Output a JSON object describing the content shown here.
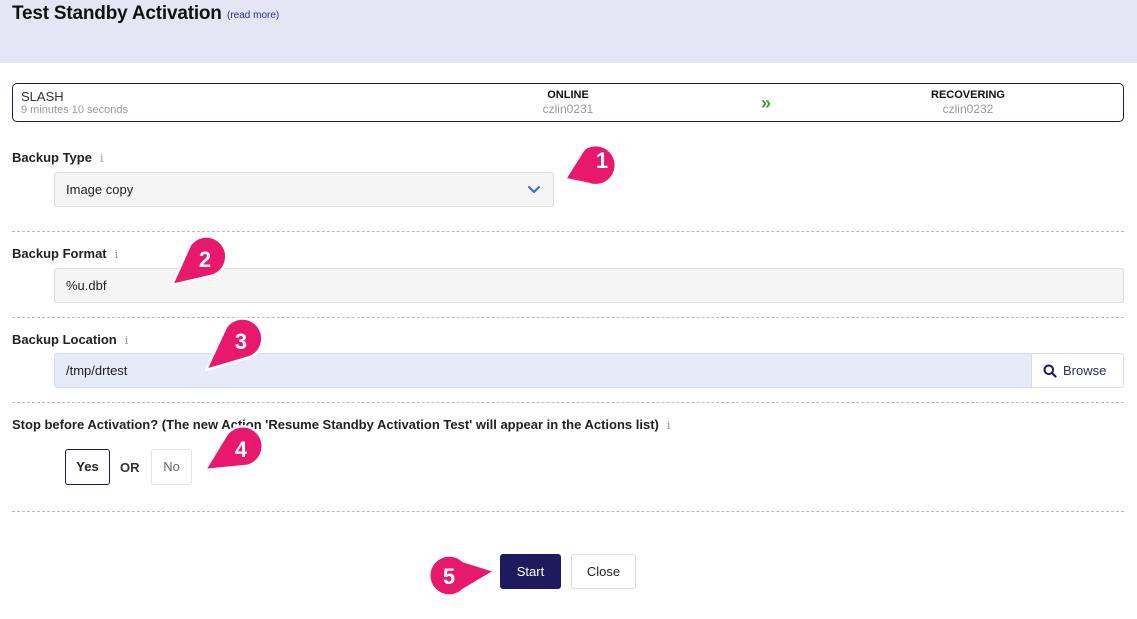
{
  "header": {
    "title": "Test Standby Activation",
    "read_more": "(read more)"
  },
  "status": {
    "db_name": "SLASH",
    "elapsed": "9 minutes 10 seconds",
    "primary_state": "ONLINE",
    "primary_host": "czlin0231",
    "standby_state": "RECOVERING",
    "standby_host": "czlin0232",
    "arrow": "»",
    "arrow_color": "#3aa32a"
  },
  "form": {
    "backup_type": {
      "label": "Backup Type",
      "info": "i",
      "selected": "Image copy"
    },
    "backup_format": {
      "label": "Backup Format",
      "info": "i",
      "value": "%u.dbf"
    },
    "backup_location": {
      "label": "Backup Location",
      "info": "i",
      "value": "/tmp/drtest",
      "browse_label": "Browse"
    },
    "stop_before": {
      "label": "Stop before Activation? (The new Action 'Resume Standby Activation Test' will appear in the Actions list)",
      "info": "i",
      "yes_label": "Yes",
      "or_label": "OR",
      "no_label": "No",
      "selected": "Yes"
    }
  },
  "actions": {
    "start_label": "Start",
    "close_label": "Close"
  },
  "callouts": [
    "1",
    "2",
    "3",
    "4",
    "5"
  ],
  "colors": {
    "header_bg": "#e5e5f6",
    "accent": "#1f1a5e",
    "callout": "#e8186d",
    "location_bg": "#e6ebfa"
  }
}
